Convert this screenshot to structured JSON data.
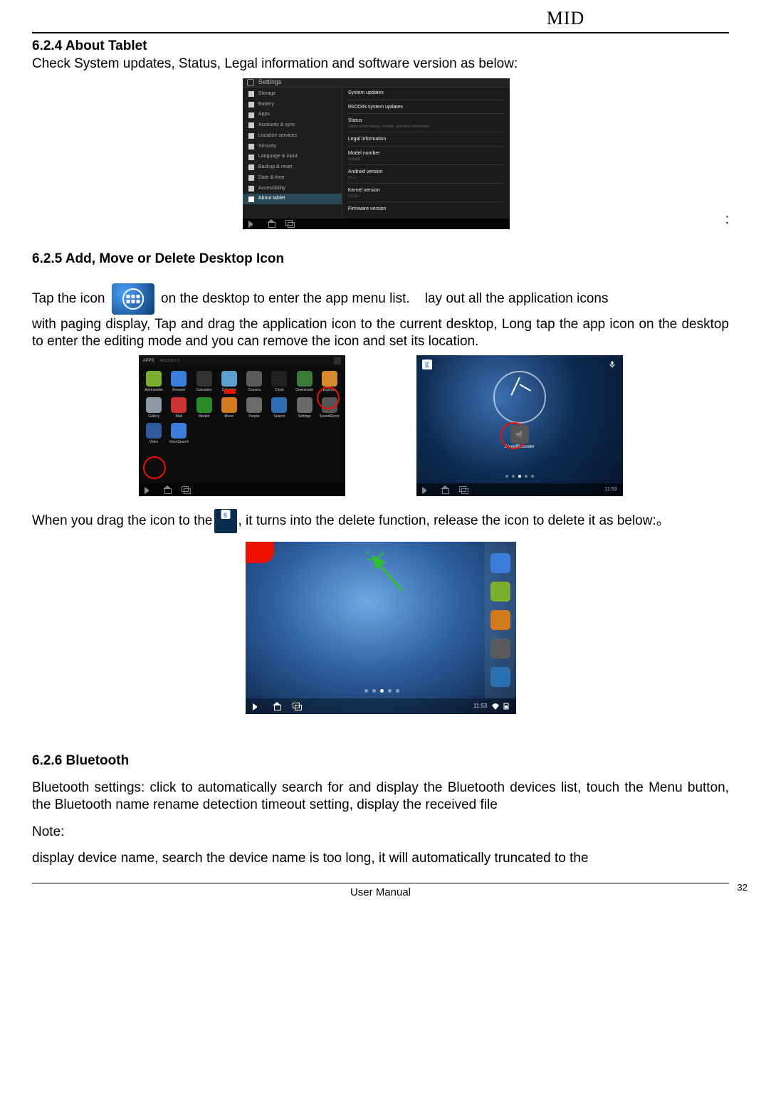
{
  "header": {
    "title": "MID"
  },
  "sections": {
    "about": {
      "heading": "6.2.4 About Tablet",
      "intro": "Check System updates, Status, Legal information and software version as below:"
    },
    "desktop": {
      "heading": "6.2.5 Add, Move or Delete Desktop Icon",
      "p1_pre": "Tap the icon ",
      "p1_post": " on the desktop to enter the app menu list.    lay out all the application icons",
      "p2": "with paging display, Tap and drag the application icon to the current desktop, Long tap the app icon on the desktop to enter the editing mode and you can remove the icon and set its location.",
      "p3_pre": "When you drag the icon to the",
      "p3_post": ", it turns into the delete function, release the icon to delete it as below:。"
    },
    "bluetooth": {
      "heading": "6.2.6 Bluetooth",
      "p1": "Bluetooth settings: click to automatically search for and display the Bluetooth devices list, touch the Menu button, the Bluetooth name rename detection timeout setting, display the received file",
      "note_label": "Note:",
      "p2": "display device name, search the device name is too long, it will automatically truncated to the"
    }
  },
  "about_screenshot": {
    "window_title": "Settings",
    "left_items": [
      "Storage",
      "Battery",
      "Apps",
      "Accounts & sync",
      "Location services",
      "Security",
      "Language & input",
      "Backup & reset",
      "Date & time",
      "Accessibility",
      "About tablet"
    ],
    "right_groups": [
      {
        "title": "System updates",
        "sub": ""
      },
      {
        "title": "RkODIN system updates",
        "sub": ""
      },
      {
        "title": "Status",
        "sub": "Status of the battery, network, and other information"
      },
      {
        "title": "Legal information",
        "sub": ""
      },
      {
        "title": "Model number",
        "sub": "rk30sdk"
      },
      {
        "title": "Android version",
        "sub": "4.1.1"
      },
      {
        "title": "Kernel version",
        "sub": "3.0.36+"
      },
      {
        "title": "Firmware version",
        "sub": ""
      }
    ]
  },
  "apps_screenshot": {
    "tabs": [
      "APPS",
      "WIDGETS"
    ],
    "apps": [
      {
        "label": "ApkInstaller",
        "color": "#7cae2e"
      },
      {
        "label": "Browser",
        "color": "#3b7dd8"
      },
      {
        "label": "Calculator",
        "color": "#333333"
      },
      {
        "label": "Calendar",
        "color": "#5aa0d0"
      },
      {
        "label": "Camera",
        "color": "#5b5b5b"
      },
      {
        "label": "Clock",
        "color": "#222222"
      },
      {
        "label": "Downloads",
        "color": "#3c7a3c"
      },
      {
        "label": "Explorer",
        "color": "#d78a2e"
      },
      {
        "label": "Gallery",
        "color": "#8a9aa6"
      },
      {
        "label": "Mail",
        "color": "#c33"
      },
      {
        "label": "Market",
        "color": "#2a8a2a"
      },
      {
        "label": "Music",
        "color": "#d17b1c"
      },
      {
        "label": "People",
        "color": "#6b6b6b"
      },
      {
        "label": "Search",
        "color": "#2d6db3"
      },
      {
        "label": "Settings",
        "color": "#6a6a6a"
      },
      {
        "label": "SoundRecorder",
        "color": "#555555"
      },
      {
        "label": "Video",
        "color": "#2f5aa0"
      },
      {
        "label": "VoiceSearch",
        "color": "#3b7dd8"
      }
    ]
  },
  "home_screenshot": {
    "center_app_label": "SoundRecorder",
    "time": "11:53"
  },
  "delete_screenshot": {
    "dock": [
      {
        "color": "#3b7dd8"
      },
      {
        "color": "#7cae2e"
      },
      {
        "color": "#d17b1c"
      },
      {
        "color": "#5b5b5b"
      },
      {
        "color": "#2a6fb0"
      }
    ],
    "time": "11:53"
  },
  "footer": {
    "label": "User Manual",
    "page": "32"
  },
  "icons": {
    "google_g": "g"
  }
}
